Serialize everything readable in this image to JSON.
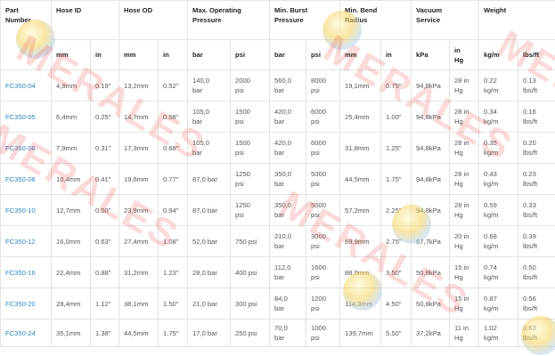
{
  "headers": {
    "part_number": "Part\nNumber",
    "hose_id": "Hose ID",
    "hose_od": "Hose OD",
    "max_pressure": "Max. Operating\nPressure",
    "burst_pressure": "Min. Burst\nPressure",
    "bend_radius": "Min. Bend\nRadius",
    "vacuum": "Vacuum\nService",
    "weight": "Weight"
  },
  "units": [
    "mm",
    "in",
    "mm",
    "in",
    "bar",
    "psi",
    "bar",
    "psi",
    "mm",
    "in",
    "kPa",
    "in\nHg",
    "kg/m",
    "lbs/ft"
  ],
  "rows": [
    [
      "FC350-04",
      "4,8mm",
      "0.19\"",
      "13,2mm",
      "0.52\"",
      "140,0\nbar",
      "2000\npsi",
      "560,0\nbar",
      "8000\npsi",
      "19,1mm",
      "0.75\"",
      "94,8kPa",
      "28 in\nHg",
      "0.22\nkg/m",
      "0.13\nlbs/ft"
    ],
    [
      "FC350-05",
      "6,4mm",
      "0.25\"",
      "14,7mm",
      "0.58\"",
      "105,0\nbar",
      "1500\npsi",
      "420,0\nbar",
      "6000\npsi",
      "25,4mm",
      "1.00\"",
      "94,8kPa",
      "28 in\nHg",
      "0.34\nkg/m",
      "0.16\nlbs/ft"
    ],
    [
      "FC350-06",
      "7,9mm",
      "0.31\"",
      "17,3mm",
      "0.68\"",
      "105,0\nbar",
      "1500\npsi",
      "420,0\nbar",
      "6000\npsi",
      "31,8mm",
      "1.25\"",
      "94,8kPa",
      "28 in\nHg",
      "0.35\nkg/m",
      "0.20\nlbs/ft"
    ],
    [
      "FC350-08",
      "10,4mm",
      "0.41\"",
      "19,6mm",
      "0.77\"",
      "87,0 bar",
      "1250\npsi",
      "350,0\nbar",
      "5000\npsi",
      "44,5mm",
      "1.75\"",
      "94,8kPa",
      "28 in\nHg",
      "0.43\nkg/m",
      "0.23\nlbs/ft"
    ],
    [
      "FC350-10",
      "12,7mm",
      "0.50\"",
      "23,9mm",
      "0.94\"",
      "87,0 bar",
      "1250\npsi",
      "350,0\nbar",
      "5000\npsi",
      "57,2mm",
      "2.25\"",
      "94,8kPa",
      "28 in\nHg",
      "0.59\nkg/m",
      "0.33\nlbs/ft"
    ],
    [
      "FC350-12",
      "16,0mm",
      "0.63\"",
      "27,4mm",
      "1.08\"",
      "52,0 bar",
      "750 psi",
      "210,0\nbar",
      "3000\npsi",
      "69,9mm",
      "2.75\"",
      "67,7kPa",
      "20 in\nHg",
      "0.68\nkg/m",
      "0.39\nlbs/ft"
    ],
    [
      "FC350-16",
      "22,4mm",
      "0.88\"",
      "31,2mm",
      "1.23\"",
      "28,0 bar",
      "400 psi",
      "112,0\nbar",
      "1600\npsi",
      "88,9mm",
      "3.50\"",
      "50,8kPa",
      "15 in\nHg",
      "0.74\nkg/m",
      "0.50\nlbs/ft"
    ],
    [
      "FC350-20",
      "28,4mm",
      "1.12\"",
      "38,1mm",
      "1.50\"",
      "21,0 bar",
      "300 psi",
      "84,0\nbar",
      "1200\npsi",
      "114,3mm",
      "4.50\"",
      "50,8kPa",
      "15 in\nHg",
      "0.87\nkg/m",
      "0.56\nlbs/ft"
    ],
    [
      "FC350-24",
      "35,1mm",
      "1.38\"",
      "44,5mm",
      "1.75\"",
      "17,0 bar",
      "250 psi",
      "70,0\nbar",
      "1000\npsi",
      "139,7mm",
      "5.50\"",
      "37,2kPa",
      "11 in\nHg",
      "1.02\nkg/m",
      "0.63\nlbs/ft"
    ]
  ],
  "watermark": {
    "text": "MERALES",
    "color": "#e84646"
  },
  "colors": {
    "part_link": "#2f86c6",
    "grid": "#e3e3e3"
  }
}
